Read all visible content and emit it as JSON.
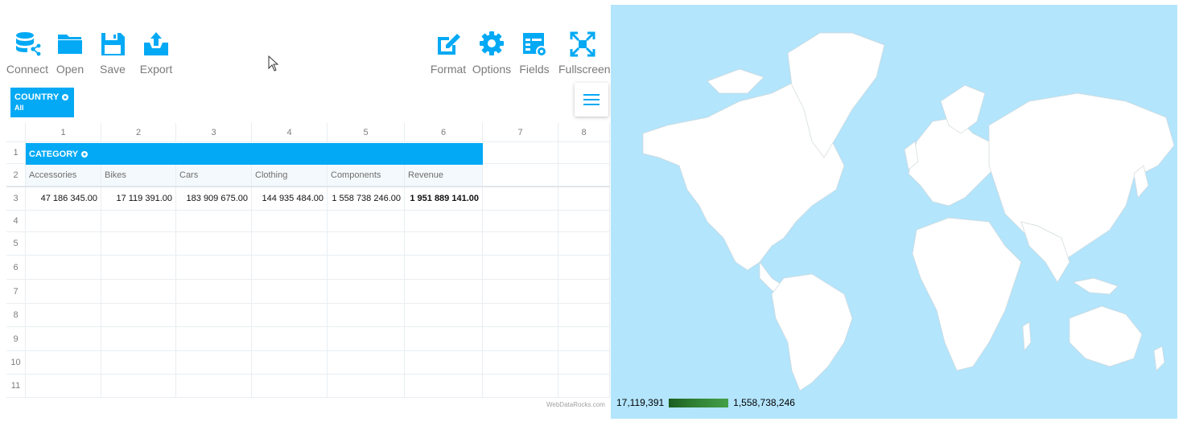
{
  "toolbar": {
    "left": [
      {
        "id": "connect",
        "label": "Connect",
        "icon": "database-share-icon"
      },
      {
        "id": "open",
        "label": "Open",
        "icon": "folder-icon"
      },
      {
        "id": "save",
        "label": "Save",
        "icon": "floppy-disk-icon"
      },
      {
        "id": "export",
        "label": "Export",
        "icon": "upload-icon"
      }
    ],
    "right": [
      {
        "id": "format",
        "label": "Format",
        "icon": "edit-icon"
      },
      {
        "id": "options",
        "label": "Options",
        "icon": "gear-icon"
      },
      {
        "id": "fields",
        "label": "Fields",
        "icon": "fields-icon"
      },
      {
        "id": "fullscreen",
        "label": "Fullscreen",
        "icon": "fullscreen-icon"
      }
    ]
  },
  "filter": {
    "title": "COUNTRY",
    "value": "All"
  },
  "grid": {
    "col_headers": [
      "1",
      "2",
      "3",
      "4",
      "5",
      "6",
      "7",
      "8"
    ],
    "row_headers": [
      "1",
      "2",
      "3",
      "4",
      "5",
      "6",
      "7",
      "8",
      "9",
      "10",
      "11"
    ],
    "category_label": "CATEGORY",
    "labels": [
      "Accessories",
      "Bikes",
      "Cars",
      "Clothing",
      "Components",
      "Revenue"
    ],
    "values": [
      "47 186 345.00",
      "17 119 391.00",
      "183 909 675.00",
      "144 935 484.00",
      "1 558 738 246.00",
      "1 951 889 141.00"
    ]
  },
  "credit": "WebDataRocks.com",
  "legend": {
    "min": "17,119,391",
    "max": "1,558,738,246"
  },
  "colors": {
    "accent": "#03a9f4",
    "ocean": "#b3e5fc",
    "land": "#ffffff",
    "legend_dark": "#1b5e20",
    "legend_light": "#43a047"
  }
}
